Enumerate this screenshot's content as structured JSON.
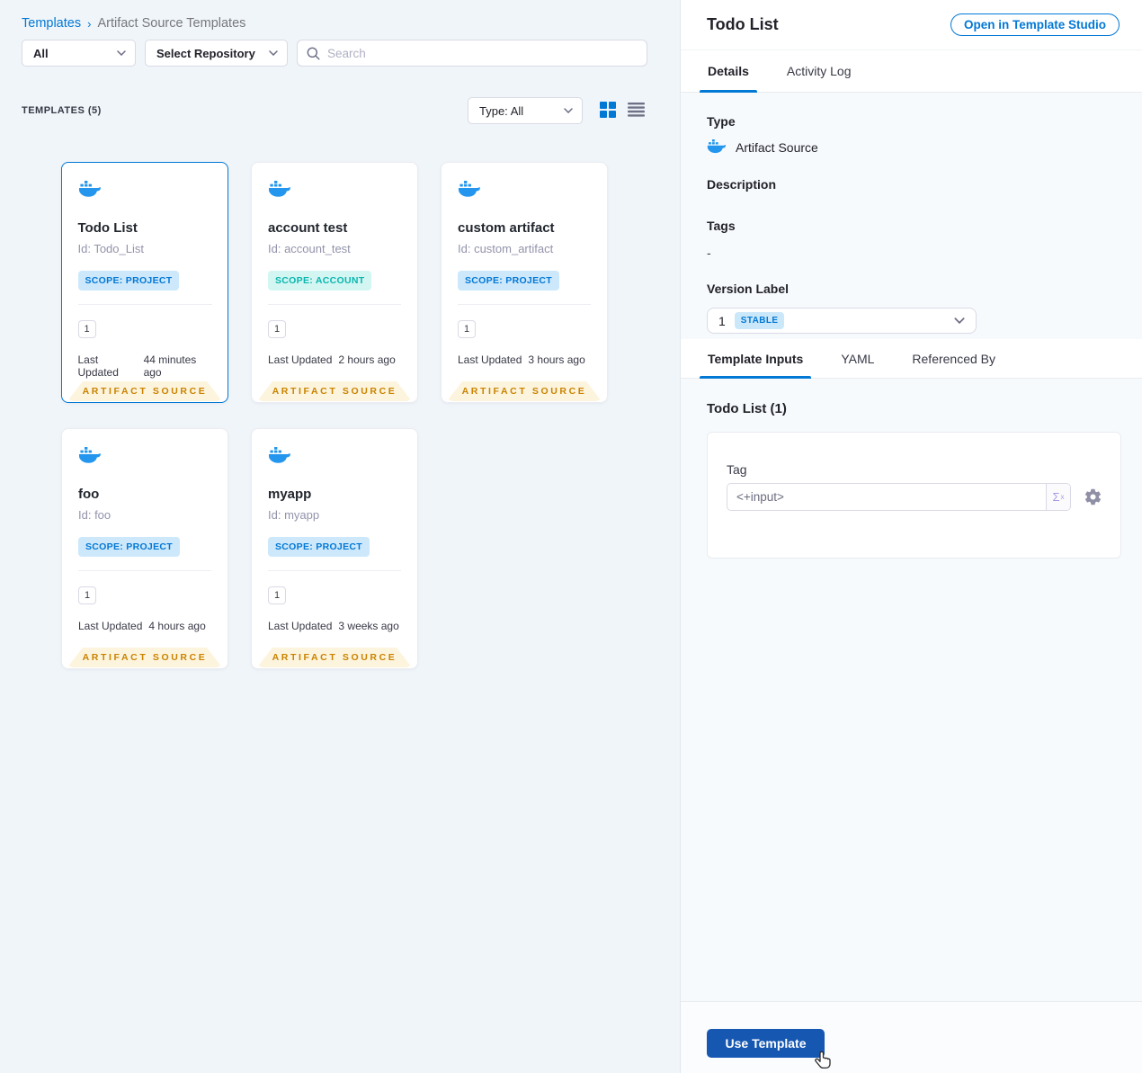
{
  "breadcrumb": {
    "templates": "Templates",
    "separator": "›",
    "current": "Artifact Source Templates"
  },
  "filters": {
    "scope_dropdown": "All",
    "repo_dropdown": "Select Repository",
    "search_placeholder": "Search"
  },
  "list_header": {
    "count_label": "TEMPLATES (5)",
    "type_dropdown": "Type: All"
  },
  "card_labels": {
    "last_updated": "Last Updated",
    "ribbon": "ARTIFACT SOURCE"
  },
  "cards": [
    {
      "title": "Todo List",
      "id": "Id: Todo_List",
      "scope": "SCOPE: PROJECT",
      "version": "1",
      "last_updated": "44 minutes ago"
    },
    {
      "title": "account test",
      "id": "Id: account_test",
      "scope": "SCOPE: ACCOUNT",
      "version": "1",
      "last_updated": "2 hours ago"
    },
    {
      "title": "custom artifact",
      "id": "Id: custom_artifact",
      "scope": "SCOPE: PROJECT",
      "version": "1",
      "last_updated": "3 hours ago"
    },
    {
      "title": "foo",
      "id": "Id: foo",
      "scope": "SCOPE: PROJECT",
      "version": "1",
      "last_updated": "4 hours ago"
    },
    {
      "title": "myapp",
      "id": "Id: myapp",
      "scope": "SCOPE: PROJECT",
      "version": "1",
      "last_updated": "3 weeks ago"
    }
  ],
  "panel": {
    "title": "Todo List",
    "open_button": "Open in Template Studio",
    "tabs": {
      "details": "Details",
      "activity_log": "Activity Log"
    },
    "details": {
      "type_label": "Type",
      "type_value": "Artifact Source",
      "description_label": "Description",
      "tags_label": "Tags",
      "tags_value": "-",
      "version_label": "Version Label",
      "version_value": "1",
      "version_badge": "STABLE"
    },
    "inner_tabs": {
      "template_inputs": "Template Inputs",
      "yaml": "YAML",
      "referenced_by": "Referenced By"
    },
    "inputs": {
      "heading": "Todo List (1)",
      "tag_label": "Tag",
      "tag_value": "<+input>",
      "sigma": "Σ",
      "sigma_sub": "x"
    },
    "footer": {
      "use_template": "Use Template"
    }
  },
  "colors": {
    "accent_blue": "#0278d5",
    "docker_blue": "#2496ed",
    "ribbon_bg": "#fdf4dd",
    "ribbon_text": "#ca8300",
    "scope_project_bg": "#cde8fb",
    "scope_account_bg": "#d3f6f3",
    "scope_account_text": "#0ab6ae",
    "stable_chip_bg": "#cbe8fa",
    "use_template_bg": "#1657b2",
    "left_panel_bg": "#eff5f9",
    "right_panel_bg": "#f7fafd"
  }
}
